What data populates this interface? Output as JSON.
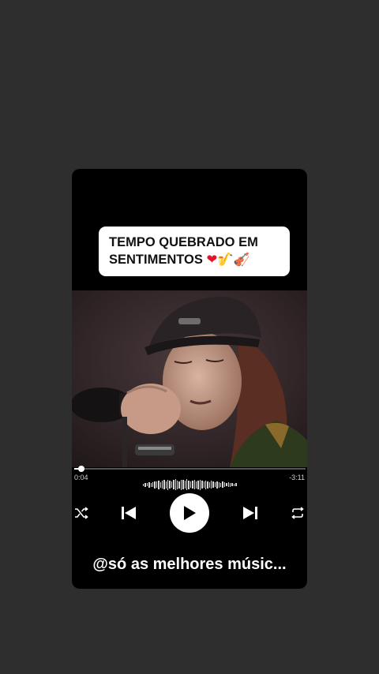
{
  "caption": {
    "line1": "TEMPO QUEBRADO EM",
    "line2": "SENTIMENTOS",
    "emoji_heart": "❤",
    "emoji_sax": "🎷",
    "emoji_violin": "🎻"
  },
  "player": {
    "elapsed": "0:04",
    "remaining": "-3:11",
    "progress_fraction": 0.03
  },
  "controls": {
    "shuffle_icon": "shuffle-icon",
    "prev_icon": "skip-previous-icon",
    "play_icon": "play-icon",
    "next_icon": "skip-next-icon",
    "repeat_icon": "repeat-icon"
  },
  "footer": {
    "handle": "@só as melhores músic..."
  },
  "colors": {
    "page_background": "#2e2e2e",
    "card_background": "#000000",
    "caption_background": "#ffffff"
  }
}
